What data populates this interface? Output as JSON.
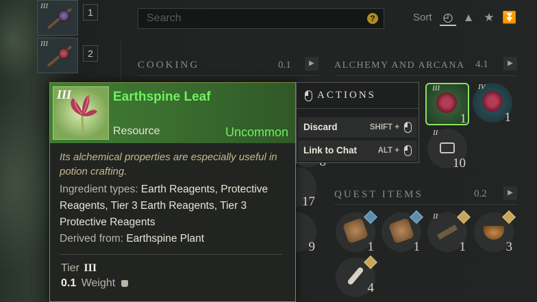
{
  "weapon_slots": [
    {
      "tier": "III",
      "hotkey": "1"
    },
    {
      "tier": "III",
      "hotkey": "2"
    }
  ],
  "search": {
    "placeholder": "Search",
    "help_icon": "?"
  },
  "sort": {
    "label": "Sort",
    "options": [
      "clock-icon",
      "weight-icon",
      "star-icon",
      "tier-icon"
    ],
    "active": "clock-icon"
  },
  "sections": {
    "cooking": {
      "title": "COOKING",
      "weight": "0.1"
    },
    "alchemy": {
      "title": "ALCHEMY AND ARCANA",
      "weight": "4.1",
      "items": [
        {
          "tier": "III",
          "qty": "1",
          "selected": true
        },
        {
          "tier": "IV",
          "qty": "1"
        },
        {
          "tier": "II",
          "qty": "10"
        }
      ]
    },
    "quest": {
      "title": "QUEST ITEMS",
      "weight": "0.2",
      "items": [
        {
          "qty": "1"
        },
        {
          "qty": "1"
        },
        {
          "tier": "II",
          "qty": "1"
        },
        {
          "qty": "3"
        },
        {
          "qty": "4"
        }
      ]
    },
    "partial_qty": [
      "8",
      "17",
      "9"
    ]
  },
  "tooltip": {
    "tier": "III",
    "name": "Earthspine Leaf",
    "type": "Resource",
    "rarity": "Uncommon",
    "rarity_color": "#6ef25e",
    "description": "Its alchemical properties are especially useful in potion crafting.",
    "ingredient_label": "Ingredient types:",
    "ingredient_value": "Earth Reagents, Protective Reagents, Tier 3 Earth Reagents, Tier 3 Protective Reagents",
    "derived_label": "Derived from:",
    "derived_value": "Earthspine Plant",
    "tier_label": "Tier",
    "tier_value": "III",
    "weight_value": "0.1",
    "weight_label": "Weight"
  },
  "actions": {
    "title": "ACTIONS",
    "items": [
      {
        "label": "Discard",
        "key": "SHIFT +"
      },
      {
        "label": "Link to Chat",
        "key": "ALT +"
      }
    ]
  }
}
